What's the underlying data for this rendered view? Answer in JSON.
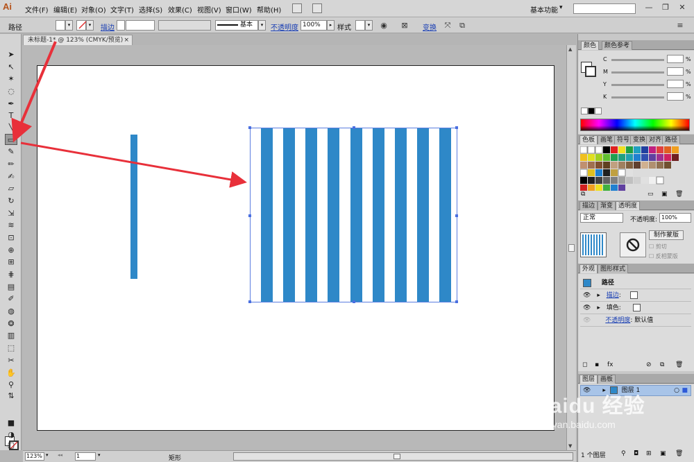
{
  "app": {
    "logo": "Ai"
  },
  "menu": [
    "文件(F)",
    "编辑(E)",
    "对象(O)",
    "文字(T)",
    "选择(S)",
    "效果(C)",
    "视图(V)",
    "窗口(W)",
    "帮助(H)"
  ],
  "workspace": {
    "label": "基本功能",
    "arrow": "▾"
  },
  "window_controls": {
    "minimize": "—",
    "restore": "❐",
    "close": "✕"
  },
  "control_bar": {
    "selection_label": "路径",
    "stroke_link": "描边",
    "style_stroke": "基本",
    "opacity_link": "不透明度",
    "opacity_value": "100%",
    "style_label": "样式",
    "transform_link": "变换"
  },
  "document_tab": {
    "title": "未标题-1* @ 123% (CMYK/预览)",
    "close": "×"
  },
  "status_bar": {
    "zoom": "123%",
    "page": "1",
    "current_tool": "矩形"
  },
  "panels": {
    "color": {
      "tabs": [
        "颜色",
        "颜色参考"
      ],
      "labels": [
        "C",
        "M",
        "Y",
        "K"
      ],
      "percent": "%"
    },
    "swatches": {
      "tabs": [
        "色板",
        "画笔",
        "符号",
        "变换",
        "对齐",
        "路径"
      ]
    },
    "transparency": {
      "tabs": [
        "描边",
        "渐变",
        "透明度"
      ],
      "mode": "正常",
      "opacity_label": "不透明度:",
      "opacity_value": "100%",
      "make_mask": "制作蒙版",
      "clip": "剪切",
      "invert": "反相蒙版"
    },
    "appearance": {
      "tabs": [
        "外观",
        "图形样式"
      ],
      "title": "路径",
      "stroke": "描边",
      "fill": "填色",
      "opacity_link": "不透明度",
      "opacity_value": "默认值",
      "separator": ":"
    },
    "layers": {
      "tabs": [
        "图层",
        "画板"
      ],
      "layer_name": "图层 1",
      "count": "1 个图层"
    }
  },
  "watermark": {
    "brand": "Baidu 经验",
    "url": "jingyan.baidu.com"
  },
  "colors": {
    "stripe": "#2e88c8",
    "accent_arrow": "#e8303a",
    "selection": "#4a6fe0"
  }
}
